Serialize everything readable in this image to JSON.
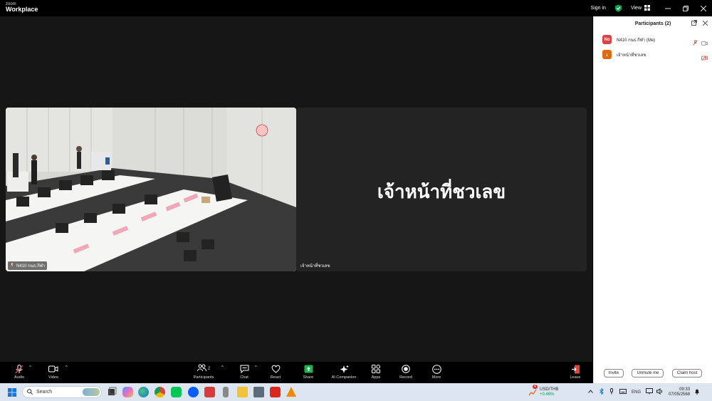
{
  "titlebar": {
    "brand_small": "zoom",
    "brand": "Workplace",
    "sign_in": "Sign in",
    "view": "View"
  },
  "stage": {
    "tiles": [
      {
        "name_tag": "N410 กนธ.กีฬา"
      },
      {
        "display_name": "เจ้าหน้าที่ชวเลข",
        "name_tag": "เจ้าหน้าที่ชวเลข"
      }
    ]
  },
  "participants_panel": {
    "title": "Participants (2)",
    "participants": [
      {
        "avatar": "No",
        "name": "N410 กนธ.กีฬา (Me)",
        "avatar_color": "#d64541"
      },
      {
        "avatar": "เ",
        "name": "เจ้าหน้าที่ชวเลข",
        "avatar_color": "#e06a12"
      }
    ],
    "buttons": {
      "invite": "Invite",
      "unmute_me": "Unmute me",
      "claim_host": "Claim host"
    }
  },
  "toolbar": {
    "audio": "Audio",
    "video": "Video",
    "participants": "Participants",
    "participants_count": "2",
    "chat": "Chat",
    "react": "React",
    "share": "Share",
    "ai_companion": "AI Companion",
    "apps": "Apps",
    "record": "Record",
    "more": "More",
    "leave": "Leave"
  },
  "taskbar": {
    "search_placeholder": "Search",
    "ticker_name": "USD/THB",
    "ticker_change": "+0.46%",
    "notify_count": "4",
    "language": "ENG",
    "time": "09:33",
    "date": "07/05/2568"
  },
  "colors": {
    "accent_green": "#0e9f4f",
    "share_green": "#22b24c",
    "mute_red": "#e0453c",
    "zoom_blue": "#0b5cff"
  }
}
